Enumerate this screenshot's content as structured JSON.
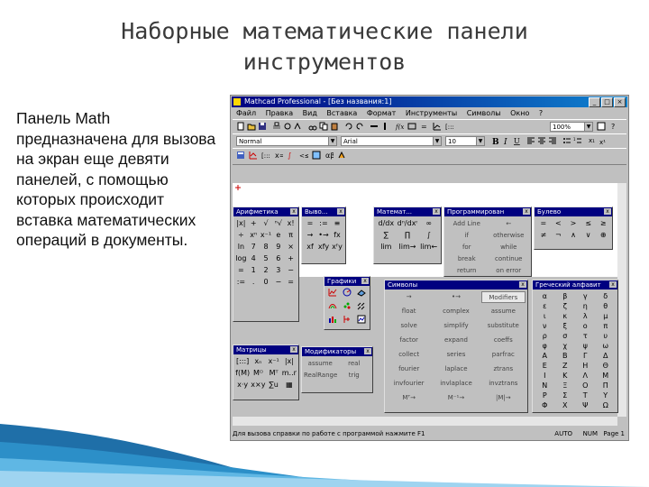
{
  "slide": {
    "title_line1": "Наборные математические панели",
    "title_line2": "инструментов",
    "body": "Панель Math предназначена для вызова на экран еще девяти панелей, с помощью которых происходит вставка математических операций в документы."
  },
  "window": {
    "title": "Mathcad Professional - [Без названия:1]",
    "controls": [
      "_",
      "□",
      "×"
    ],
    "menu": [
      "Файл",
      "Правка",
      "Вид",
      "Вставка",
      "Формат",
      "Инструменты",
      "Символы",
      "Окно",
      "?"
    ],
    "style_combo": "Normal",
    "font_combo": "Arial",
    "size_combo": "10",
    "zoom_combo": "100%",
    "status_text": "Для вызова справки по работе с программой нажмите F1",
    "status_right": [
      "AUTO",
      "NUM",
      "Page 1"
    ]
  },
  "panels": {
    "arithmetic": {
      "title": "Арифметика",
      "items": [
        "|x|",
        "+",
        "√",
        "ⁿ√",
        "x!",
        "÷",
        "xⁿ",
        "x⁻¹",
        "e",
        "π",
        "ln",
        "7",
        "8",
        "9",
        "×",
        "log",
        "4",
        "5",
        "6",
        "+",
        "=",
        "1",
        "2",
        "3",
        "−",
        ":=",
        ".",
        "0",
        "−",
        "="
      ]
    },
    "evaluation": {
      "title": "Выво...",
      "items": [
        "=",
        ":=",
        "≡",
        "→",
        "•→",
        "fx",
        "xf",
        "xfy",
        "xᶠy"
      ]
    },
    "calculus": {
      "title": "Математ...",
      "items": [
        "d/dx",
        "dⁿ/dxⁿ",
        "∞",
        "∑",
        "∏",
        "∫",
        "lim",
        "lim→",
        "lim←"
      ]
    },
    "programming": {
      "title": "Программирован",
      "items": [
        "Add Line",
        "←",
        "if",
        "otherwise",
        "for",
        "while",
        "break",
        "continue",
        "return",
        "on error"
      ]
    },
    "boolean": {
      "title": "Булево",
      "items": [
        "=",
        "<",
        ">",
        "≤",
        "≥",
        "≠",
        "¬",
        "∧",
        "∨",
        "⊕"
      ]
    },
    "graphs": {
      "title": "Графики",
      "icons": [
        "xy-plot-icon",
        "polar-plot-icon",
        "surface-plot-icon",
        "contour-plot-icon",
        "scatter-3d-icon",
        "vector-field-icon",
        "bar-3d-icon",
        "box-plot-icon",
        "animation-icon"
      ]
    },
    "matrices": {
      "title": "Матрицы",
      "items": [
        "[:::]",
        "xₙ",
        "x⁻¹",
        "|x|",
        "f(M)",
        "M⁽⁾",
        "Mᵀ",
        "m..n",
        "x·y",
        "x×y",
        "∑u",
        "▦"
      ]
    },
    "modifiers": {
      "title": "Модификаторы",
      "items": [
        "assume",
        "real",
        "RealRange",
        "trig"
      ]
    },
    "symbols": {
      "title": "Символы",
      "items": [
        "→",
        "•→",
        "Modifiers",
        "float",
        "complex",
        "assume",
        "solve",
        "simplify",
        "substitute",
        "factor",
        "expand",
        "coeffs",
        "collect",
        "series",
        "parfrac",
        "fourier",
        "laplace",
        "ztrans",
        "invfourier",
        "invlaplace",
        "invztrans",
        "Mᵀ→",
        "M⁻¹→",
        "|M|→"
      ]
    },
    "greek": {
      "title": "Греческий алфавит",
      "items": [
        "α",
        "β",
        "γ",
        "δ",
        "ε",
        "ζ",
        "η",
        "θ",
        "ι",
        "κ",
        "λ",
        "μ",
        "ν",
        "ξ",
        "ο",
        "π",
        "ρ",
        "σ",
        "τ",
        "υ",
        "φ",
        "χ",
        "ψ",
        "ω",
        "Α",
        "Β",
        "Γ",
        "Δ",
        "Ε",
        "Ζ",
        "Η",
        "Θ",
        "Ι",
        "Κ",
        "Λ",
        "Μ",
        "Ν",
        "Ξ",
        "Ο",
        "Π",
        "Ρ",
        "Σ",
        "Τ",
        "Υ",
        "Φ",
        "Χ",
        "Ψ",
        "Ω"
      ]
    }
  }
}
